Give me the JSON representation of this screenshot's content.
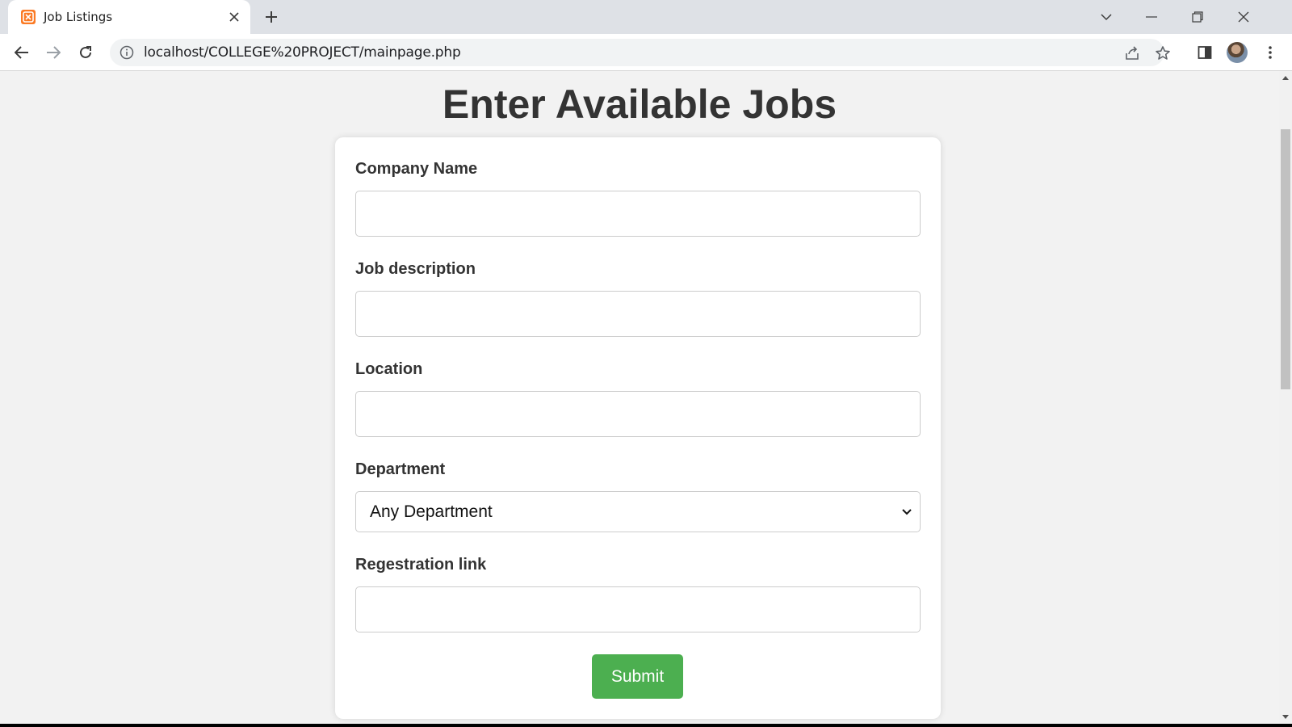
{
  "browser": {
    "tab": {
      "title": "Job Listings",
      "favicon": "xampp-icon"
    },
    "url": "localhost/COLLEGE%20PROJECT/mainpage.php",
    "icons": [
      "back-icon",
      "forward-icon",
      "reload-icon",
      "info-icon",
      "share-icon",
      "star-icon",
      "side-panel-icon",
      "profile-avatar",
      "menu-icon",
      "tab-search-icon",
      "minimize-icon",
      "restore-icon",
      "close-icon"
    ]
  },
  "page": {
    "title": "Enter Available Jobs",
    "form": {
      "company_name": {
        "label": "Company Name",
        "value": ""
      },
      "job_description": {
        "label": "Job description",
        "value": ""
      },
      "location": {
        "label": "Location",
        "value": ""
      },
      "department": {
        "label": "Department",
        "selected": "Any Department"
      },
      "registration_link": {
        "label": "Regestration link",
        "value": ""
      },
      "submit_label": "Submit"
    }
  },
  "colors": {
    "page_background": "#f2f2f2",
    "submit_button": "#4caf50",
    "title_text": "#333333"
  }
}
